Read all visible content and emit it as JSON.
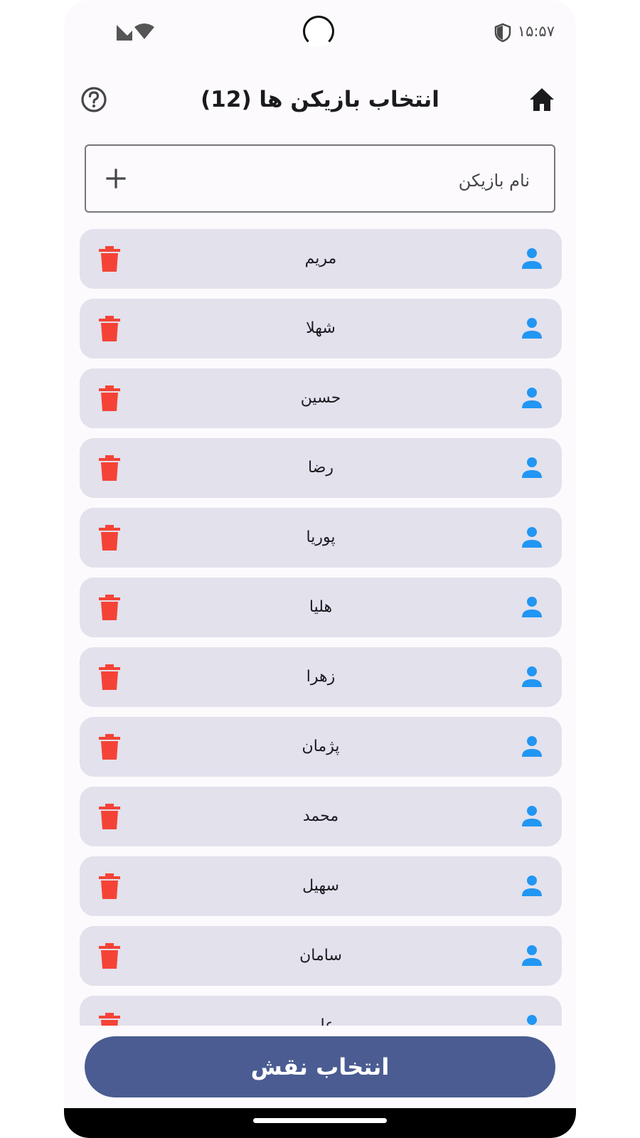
{
  "status_bar": {
    "time": "۱۵:۵۷",
    "icons": [
      "shield-icon",
      "signal-icon",
      "wifi-icon"
    ]
  },
  "app_bar": {
    "title": "انتخاب بازیکن ها (12)",
    "home_icon": "home-icon",
    "help_icon": "help-circle-icon"
  },
  "add_player": {
    "placeholder": "نام بازیکن",
    "value": "",
    "add_icon": "plus-icon"
  },
  "players": [
    {
      "name": "مریم"
    },
    {
      "name": "شهلا"
    },
    {
      "name": "حسین"
    },
    {
      "name": "رضا"
    },
    {
      "name": "پوریا"
    },
    {
      "name": "هلیا"
    },
    {
      "name": "زهرا"
    },
    {
      "name": "پژمان"
    },
    {
      "name": "محمد"
    },
    {
      "name": "سهیل"
    },
    {
      "name": "سامان"
    },
    {
      "name": "علی"
    }
  ],
  "footer": {
    "button_label": "انتخاب نقش"
  },
  "colors": {
    "primary": "#4a5c91",
    "card_background": "#e2e1ec",
    "person_icon": "#2196f3",
    "delete_icon": "#f44336",
    "background": "#fcfafd"
  }
}
